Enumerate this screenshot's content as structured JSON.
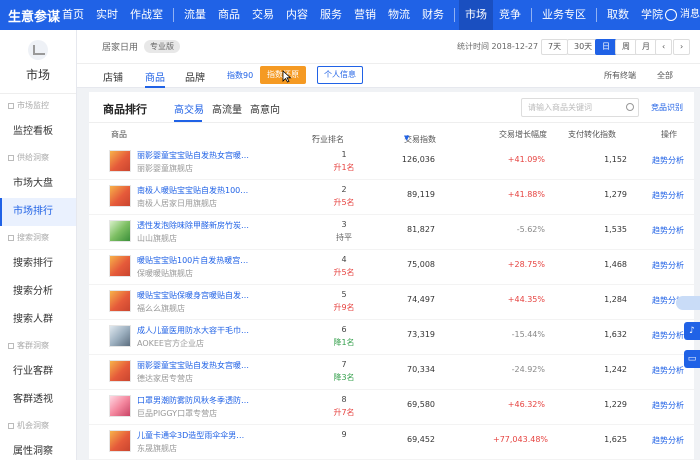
{
  "nav": {
    "brand": "生意参谋",
    "group1": [
      "首页",
      "实时",
      "作战室"
    ],
    "group2": [
      "流量",
      "商品",
      "交易",
      "内容",
      "服务",
      "营销",
      "物流",
      "财务"
    ],
    "group3": [
      "市场",
      "竞争"
    ],
    "group4": [
      "业务专区"
    ],
    "group5": [
      "取数",
      "学院"
    ],
    "active": "市场",
    "user": "消息"
  },
  "sidebar": {
    "title": "市场",
    "sections": [
      {
        "group": "市场监控",
        "items": [
          "监控看板"
        ]
      },
      {
        "group": "供给洞察",
        "items": [
          "市场大盘",
          "市场排行"
        ]
      },
      {
        "group": "搜索洞察",
        "items": [
          "搜索排行",
          "搜索分析",
          "搜索人群"
        ]
      },
      {
        "group": "客群洞察",
        "items": [
          "行业客群",
          "客群透视"
        ]
      },
      {
        "group": "机会洞察",
        "items": [
          "属性洞察"
        ]
      }
    ],
    "active_item": "市场排行"
  },
  "filters": {
    "category": "居家日用",
    "badge": "专业版",
    "stat_time_label": "统计时间 2018-12-27",
    "ranges": [
      "7天",
      "30天",
      "日",
      "周",
      "月"
    ],
    "active_range": "日"
  },
  "tabs": {
    "items": [
      "店铺",
      "商品",
      "品牌"
    ],
    "active": "商品",
    "index_link": "指数90",
    "convert_btn": "指数还原",
    "personal_btn": "个人信息",
    "terminal": "所有终端",
    "scope": "全部"
  },
  "panel": {
    "title": "商品排行",
    "subtabs": [
      "高交易",
      "高流量",
      "高意向"
    ],
    "active_subtab": "高交易",
    "search_placeholder": "请输入商品关键词",
    "link": "竞品识别",
    "columns": [
      "商品",
      "行业排名",
      "交易指数",
      "交易增长幅度",
      "支付转化指数",
      "操作"
    ]
  },
  "rows": [
    {
      "name": "丽影婴童宝宝贴自发热女宫暖肪暖保...",
      "shop": "丽影婴童旗舰店",
      "rank": "1",
      "rank_change": "升1名",
      "dir": "up",
      "index": "126,036",
      "growth": "+41.09%",
      "gdir": "up",
      "conv": "1,152",
      "action": "趋势分析"
    },
    {
      "name": "南极人暖贴宝宝贴自发热100片装宫...",
      "shop": "南极人居家日用旗舰店",
      "rank": "2",
      "rank_change": "升5名",
      "dir": "up",
      "index": "89,119",
      "growth": "+41.88%",
      "gdir": "up",
      "conv": "1,279",
      "action": "趋势分析"
    },
    {
      "name": "透性发泡除味除甲醛新房竹炭包去味...",
      "shop": "山山旗舰店",
      "rank": "3",
      "rank_change": "持平",
      "dir": "flat",
      "index": "81,827",
      "growth": "-5.62%",
      "gdir": "down",
      "conv": "1,535",
      "action": "趋势分析"
    },
    {
      "name": "暖贴宝宝贴100片自发热暖宫贴贴宝...",
      "shop": "保暖暖贴旗舰店",
      "rank": "4",
      "rank_change": "升5名",
      "dir": "up",
      "index": "75,008",
      "growth": "+28.75%",
      "gdir": "up",
      "conv": "1,468",
      "action": "趋势分析"
    },
    {
      "name": "暖贴宝宝贴保暖身宫暖贴自发热女...",
      "shop": "福么么旗舰店",
      "rank": "5",
      "rank_change": "升9名",
      "dir": "up",
      "index": "74,497",
      "growth": "+44.35%",
      "gdir": "up",
      "conv": "1,284",
      "action": "趋势分析"
    },
    {
      "name": "成人儿童医用防水大容干毛巾女宫儿...",
      "shop": "AOKEE官方企业店",
      "rank": "6",
      "rank_change": "降1名",
      "dir": "down",
      "index": "73,319",
      "growth": "-15.44%",
      "gdir": "down",
      "conv": "1,632",
      "action": "趋势分析"
    },
    {
      "name": "丽影婴童宝宝贴自发热女宫暖肪暖保...",
      "shop": "德达家居专营店",
      "rank": "7",
      "rank_change": "降3名",
      "dir": "down",
      "index": "70,334",
      "growth": "-24.92%",
      "gdir": "down",
      "conv": "1,242",
      "action": "趋势分析"
    },
    {
      "name": "口罩男潮防雾防风秋冬季透防个性女...",
      "shop": "巨品PIGGY口罩专营店",
      "rank": "8",
      "rank_change": "升7名",
      "dir": "up",
      "index": "69,580",
      "growth": "+46.32%",
      "gdir": "up",
      "conv": "1,229",
      "action": "趋势分析"
    },
    {
      "name": "儿童卡通伞3D造型雨伞伞男女孩子...",
      "shop": "东晟旗舰店",
      "rank": "9",
      "rank_change": "",
      "dir": "up",
      "index": "69,452",
      "growth": "+77,043.48%",
      "gdir": "up",
      "conv": "1,625",
      "action": "趋势分析"
    }
  ]
}
